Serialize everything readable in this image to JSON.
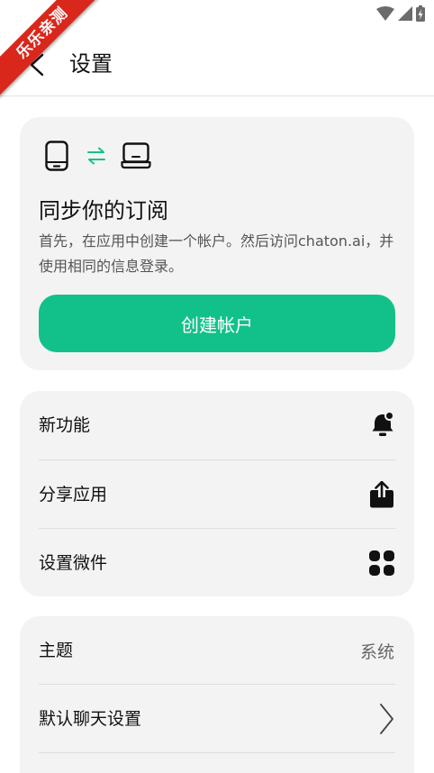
{
  "watermark": {
    "text": "乐乐亲测"
  },
  "header": {
    "title": "设置"
  },
  "sync": {
    "title": "同步你的订阅",
    "description": "首先，在应用中创建一个帐户。然后访问chaton.ai，并使用相同的信息登录。",
    "button_label": "创建帐户",
    "accent_color": "#12c189"
  },
  "menu1": {
    "items": [
      {
        "label": "新功能",
        "icon": "bell-icon"
      },
      {
        "label": "分享应用",
        "icon": "share-icon"
      },
      {
        "label": "设置微件",
        "icon": "widgets-icon"
      }
    ]
  },
  "menu2": {
    "items": [
      {
        "label": "主题",
        "value": "系统"
      },
      {
        "label": "默认聊天设置",
        "icon": "chevron-right-icon"
      }
    ]
  }
}
